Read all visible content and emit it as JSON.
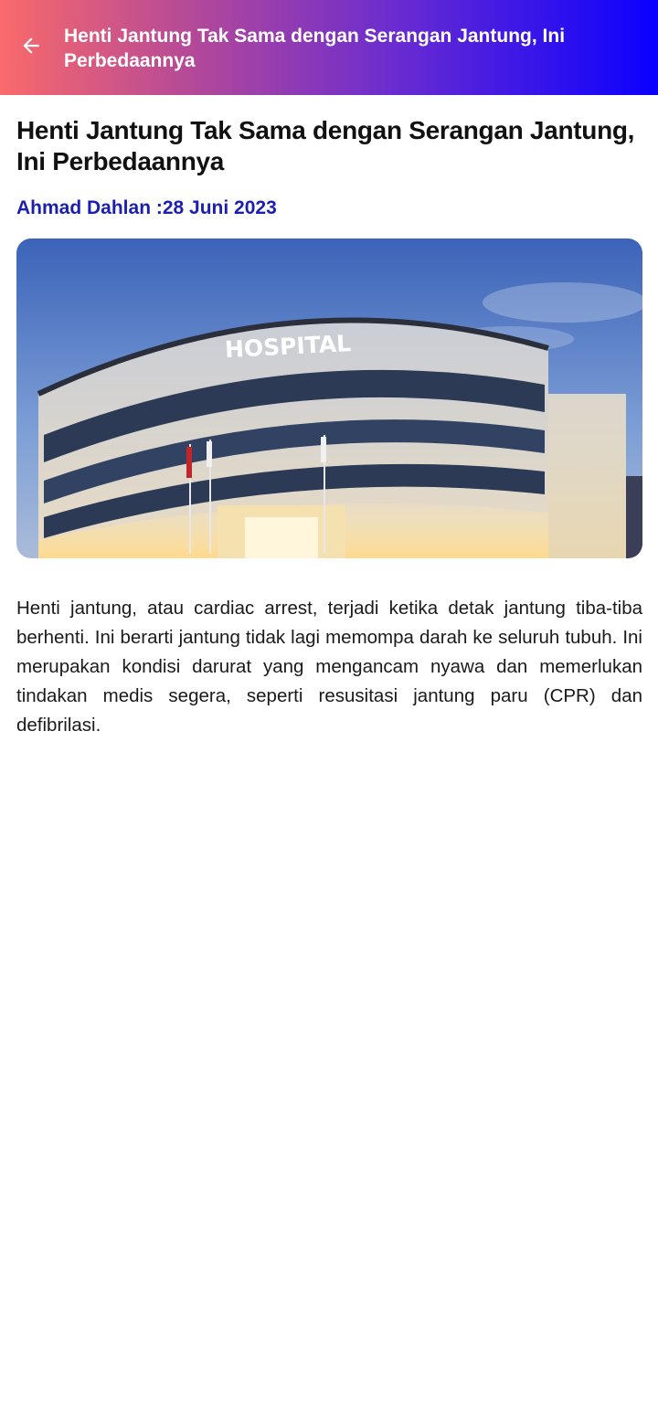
{
  "appbar": {
    "title": "Henti Jantung Tak Sama dengan Serangan Jantung, Ini Perbedaannya",
    "back_icon": "arrow-left-icon"
  },
  "article": {
    "title": "Henti Jantung Tak Sama dengan Serangan Jantung, Ini Perbedaannya",
    "byline": "Ahmad Dahlan :28 Juni 2023",
    "image_sign": "HOSPITAL",
    "body": "Henti jantung, atau cardiac arrest, terjadi ketika detak jantung tiba-tiba berhenti. Ini berarti jantung tidak lagi memompa darah ke seluruh tubuh. Ini merupakan kondisi darurat yang mengancam nyawa dan memerlukan tindakan medis segera, seperti resusitasi jantung paru (CPR) dan defibrilasi."
  },
  "colors": {
    "gradient_start": "#f96a6a",
    "gradient_end": "#0a00ff",
    "byline": "#1b1fb0"
  }
}
